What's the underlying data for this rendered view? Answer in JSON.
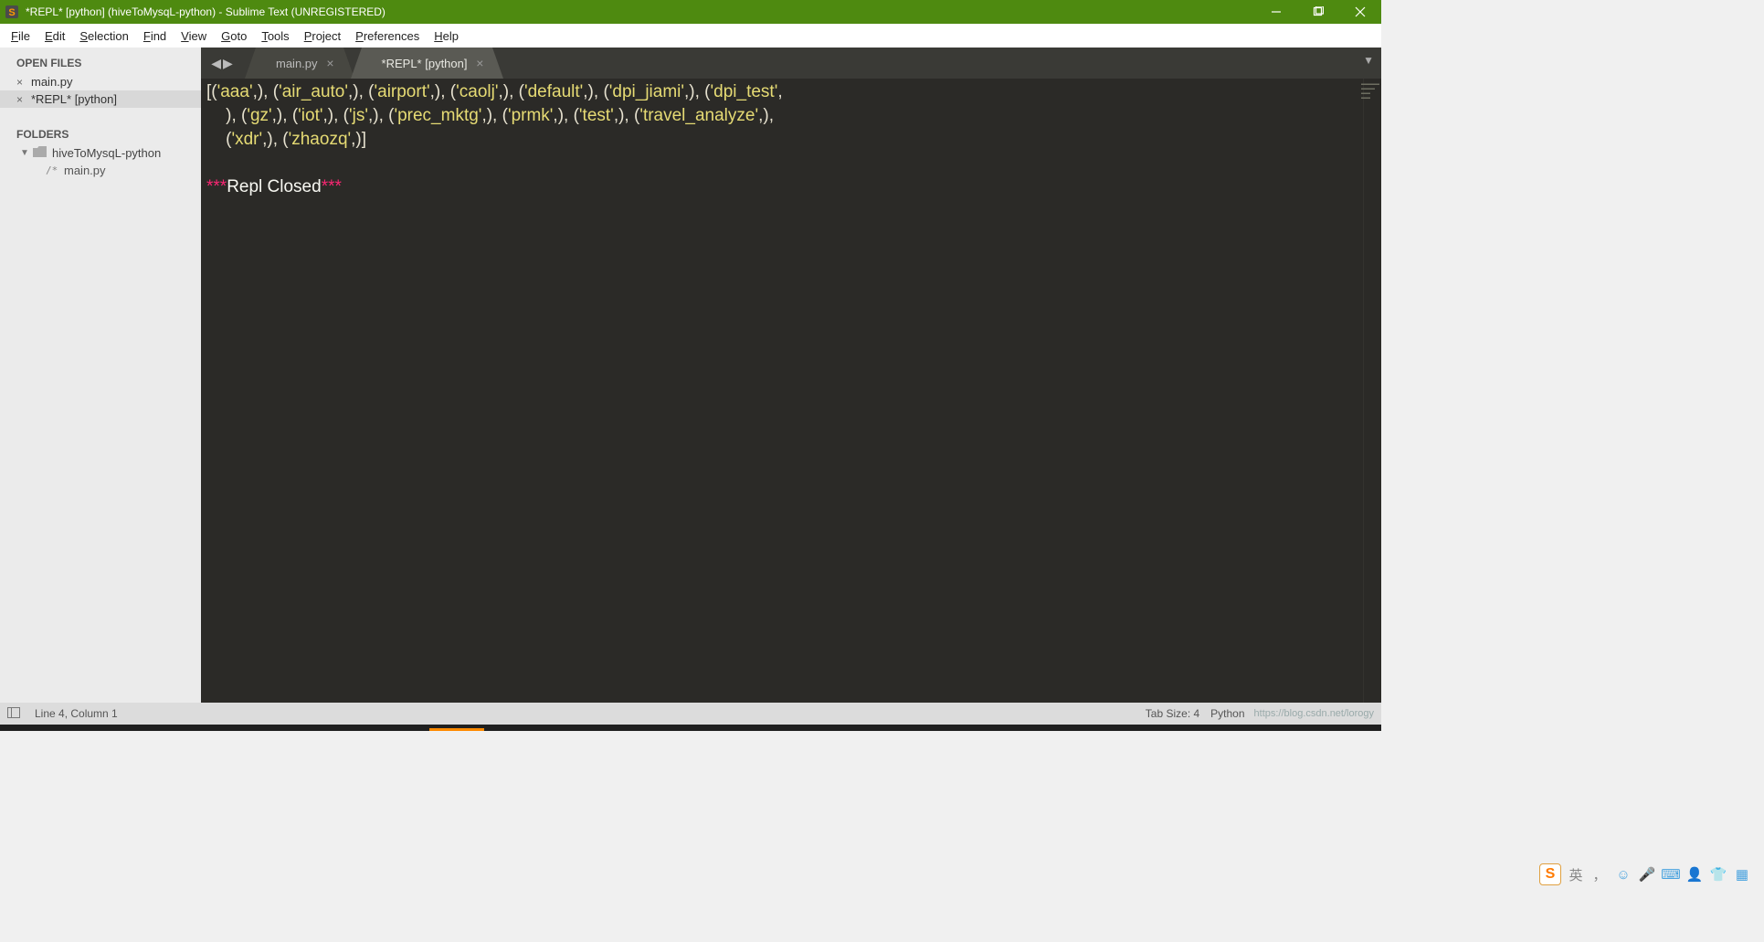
{
  "titlebar": {
    "title": "*REPL* [python] (hiveToMysqL-python) - Sublime Text (UNREGISTERED)"
  },
  "menubar": {
    "items": [
      {
        "hot": "F",
        "rest": "ile"
      },
      {
        "hot": "E",
        "rest": "dit"
      },
      {
        "hot": "S",
        "rest": "election"
      },
      {
        "hot": "F",
        "rest": "ind"
      },
      {
        "hot": "V",
        "rest": "iew"
      },
      {
        "hot": "G",
        "rest": "oto"
      },
      {
        "hot": "T",
        "rest": "ools"
      },
      {
        "hot": "P",
        "rest": "roject"
      },
      {
        "hot": "P",
        "rest": "references"
      },
      {
        "hot": "H",
        "rest": "elp"
      }
    ]
  },
  "sidebar": {
    "open_files_header": "OPEN FILES",
    "open_files": [
      {
        "name": "main.py",
        "active": false
      },
      {
        "name": "*REPL* [python]",
        "active": true
      }
    ],
    "folders_header": "FOLDERS",
    "folder": {
      "name": "hiveToMysqL-python"
    },
    "folder_files": [
      {
        "glyph": "/*",
        "name": "main.py"
      }
    ]
  },
  "tabs": {
    "items": [
      {
        "label": "main.py",
        "active": false
      },
      {
        "label": "*REPL* [python]",
        "active": true
      }
    ]
  },
  "editor": {
    "line1_a": "[(",
    "line1_s1": "'aaa'",
    "line1_b": ",), (",
    "line1_s2": "'air_auto'",
    "line1_c": ",), (",
    "line1_s3": "'airport'",
    "line1_d": ",), (",
    "line1_s4": "'caolj'",
    "line1_e": ",), (",
    "line1_s5": "'default'",
    "line1_f": ",), (",
    "line1_s6": "'dpi_jiami'",
    "line1_g": ",), (",
    "line1_s7": "'dpi_test'",
    "line1_h": ",",
    "line2_a": "    ), (",
    "line2_s1": "'gz'",
    "line2_b": ",), (",
    "line2_s2": "'iot'",
    "line2_c": ",), (",
    "line2_s3": "'js'",
    "line2_d": ",), (",
    "line2_s4": "'prec_mktg'",
    "line2_e": ",), (",
    "line2_s5": "'prmk'",
    "line2_f": ",), (",
    "line2_s6": "'test'",
    "line2_g": ",), (",
    "line2_s7": "'travel_analyze'",
    "line2_h": ",),",
    "line3_a": "    (",
    "line3_s1": "'xdr'",
    "line3_b": ",), (",
    "line3_s2": "'zhaozq'",
    "line3_c": ",)]",
    "closed_stars_l": "***",
    "closed_text": "Repl Closed",
    "closed_stars_r": "***"
  },
  "statusbar": {
    "cursor": "Line 4, Column 1",
    "tabsize": "Tab Size: 4",
    "syntax": "Python",
    "watermark": "https://blog.csdn.net/lorogy"
  },
  "ime": {
    "lang": "英"
  }
}
